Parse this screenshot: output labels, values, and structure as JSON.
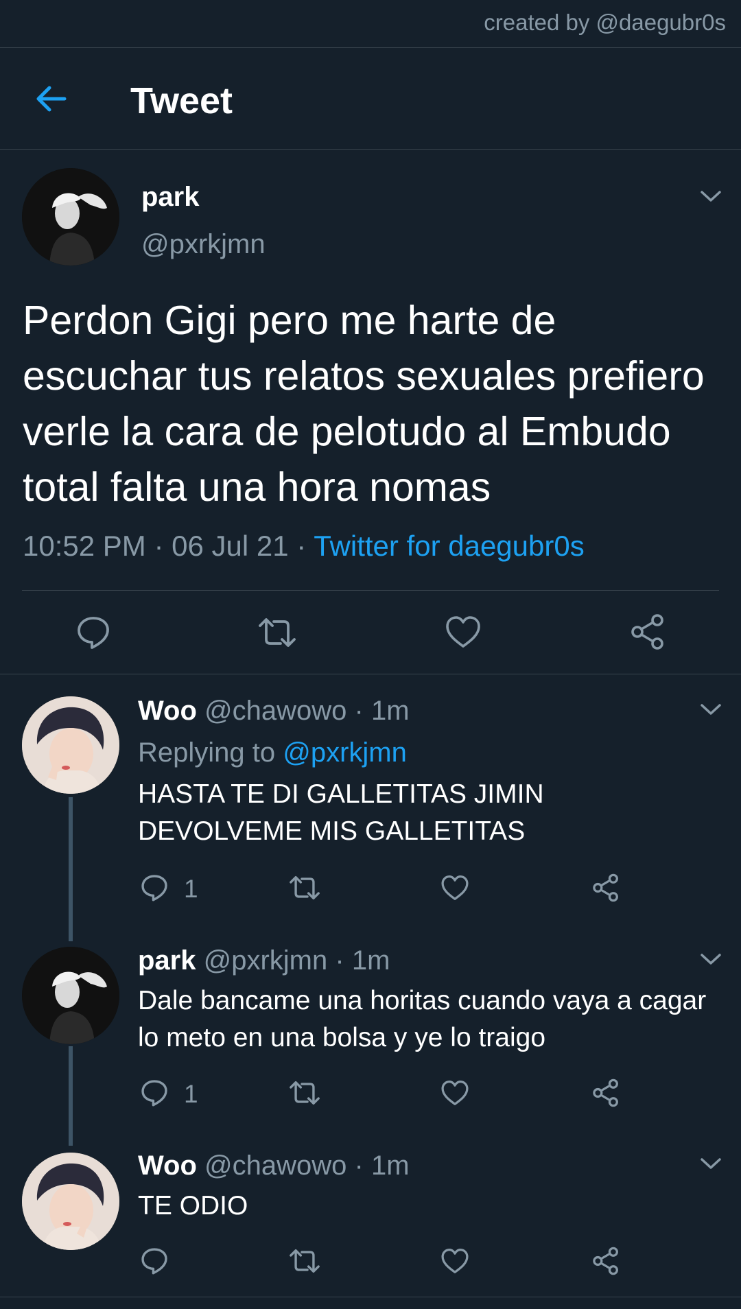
{
  "credit": "created by @daegubr0s",
  "header": {
    "title": "Tweet"
  },
  "main_tweet": {
    "name": "park",
    "handle": "@pxrkjmn",
    "text": "Perdon Gigi pero me harte de escuchar tus relatos sexuales prefiero verle la cara de pelotudo al Embudo total falta una hora nomas",
    "time": "10:52 PM",
    "date": "06 Jul 21",
    "separator": "·",
    "source": "Twitter for daegubr0s"
  },
  "replies": [
    {
      "name": "Woo",
      "handle": "@chawowo",
      "time": "1m",
      "replying_label": "Replying to",
      "replying_to": "@pxrkjmn",
      "text": "HASTA TE DI GALLETITAS JIMIN DEVOLVEME MIS GALLETITAS",
      "reply_count": "1"
    },
    {
      "name": "park",
      "handle": "@pxrkjmn",
      "time": "1m",
      "text": "Dale bancame una horitas cuando vaya a cagar lo meto en una bolsa y ye lo traigo",
      "reply_count": "1"
    },
    {
      "name": "Woo",
      "handle": "@chawowo",
      "time": "1m",
      "text": "TE ODIO"
    }
  ],
  "icons": {
    "back": "arrow-left-icon",
    "chevron": "chevron-down-icon",
    "reply": "speech-bubble-icon",
    "retweet": "retweet-icon",
    "like": "heart-icon",
    "share": "share-icon"
  },
  "colors": {
    "background": "#15202b",
    "accent": "#1da1f2",
    "muted": "#8899a6",
    "divider": "#38444d"
  }
}
